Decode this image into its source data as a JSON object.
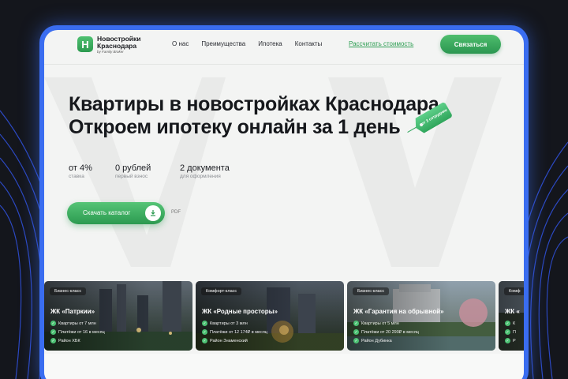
{
  "brand": {
    "logo_letter": "Н",
    "name_line1": "Новостройки",
    "name_line2": "Краснодара",
    "tagline": "by Family Broker"
  },
  "nav": {
    "items": [
      "О нас",
      "Преимущества",
      "Ипотека",
      "Контакты"
    ],
    "calc_link": "Рассчитать стоимость",
    "contact_button": "Связаться"
  },
  "hero": {
    "title_line1": "Квартиры в новостройках Краснодара.",
    "title_line2": "Откроем ипотеку онлайн за 1 день",
    "tag_text": "от 3 сотрудник"
  },
  "stats": [
    {
      "value": "от 4%",
      "label": "ставка"
    },
    {
      "value": "0 рублей",
      "label": "первый взнос"
    },
    {
      "value": "2 документа",
      "label": "для оформления"
    }
  ],
  "catalog": {
    "button_label": "Скачать каталог",
    "format": "PDF",
    "icon": "download-icon"
  },
  "cards": [
    {
      "badge": "Бизнес-класс",
      "title": "ЖК «Патркии»",
      "features": [
        "Квартиры от 7 млн",
        "Платёжи от 16 в месяц",
        "Район ХБК"
      ]
    },
    {
      "badge": "Комфорт-класс",
      "title": "ЖК «Родные просторы»",
      "features": [
        "Квартиры от 3 млн",
        "Платёжи от 12 174₽ в месяц",
        "Район Знаменский"
      ]
    },
    {
      "badge": "Бизнес-класс",
      "title": "ЖК «Гарантия на обрывной»",
      "features": [
        "Квартиры от 5 млн",
        "Платёжи от 20 290₽ в месяц",
        "Район Дубинка"
      ]
    },
    {
      "badge": "Комф",
      "title": "ЖК «",
      "features": [
        "К",
        "П",
        "Р"
      ]
    }
  ],
  "colors": {
    "accent_green": "#2d9d52",
    "frame_blue": "#3a6df0",
    "page_bg": "#f3f4f3",
    "outer_bg": "#14161c"
  }
}
